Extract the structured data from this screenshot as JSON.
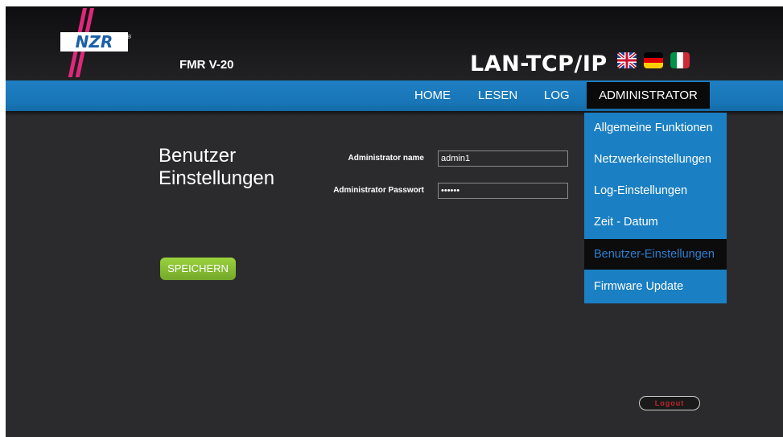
{
  "header": {
    "logo_text": "NZR",
    "device_name": "FMR V-20",
    "product_title": "LAN-TCP/IP",
    "languages": [
      "english-flag-icon",
      "german-flag-icon",
      "italian-flag-icon"
    ]
  },
  "nav": {
    "home": "HOME",
    "lesen": "LESEN",
    "log": "LOG",
    "admin": "ADMINISTRATOR"
  },
  "admin_menu": {
    "items": [
      "Allgemeine Funktionen",
      "Netzwerkeinstellungen",
      "Log-Einstellungen",
      "Zeit - Datum",
      "Benutzer-Einstellungen",
      "Firmware Update"
    ],
    "active_index": 4
  },
  "page": {
    "title_line1": "Benutzer",
    "title_line2": "Einstellungen"
  },
  "form": {
    "name_label": "Administrator name",
    "name_value": "admin1",
    "password_label": "Administrator Passwort",
    "password_value": "••••••",
    "save_label": "SPEICHERN"
  },
  "logout_label": "Logout",
  "colors": {
    "nav_blue": "#1a7fc3",
    "active_text": "#2d7fd0",
    "save_green": "#8cc63f",
    "logout_red": "#c1272d"
  }
}
